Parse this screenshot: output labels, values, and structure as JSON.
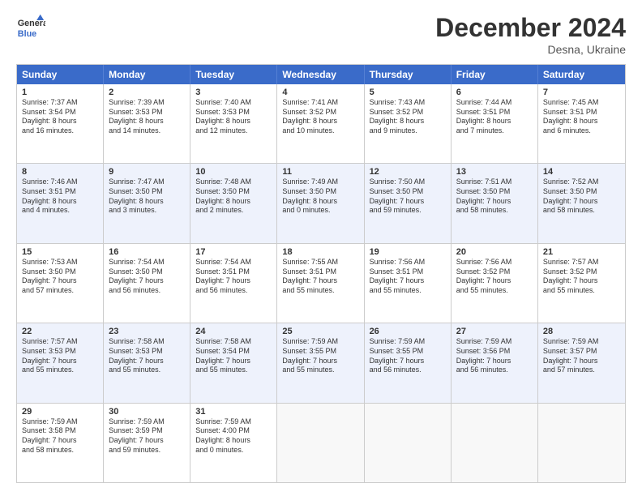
{
  "header": {
    "logo_line1": "General",
    "logo_line2": "Blue",
    "title": "December 2024",
    "subtitle": "Desna, Ukraine"
  },
  "days_of_week": [
    "Sunday",
    "Monday",
    "Tuesday",
    "Wednesday",
    "Thursday",
    "Friday",
    "Saturday"
  ],
  "weeks": [
    [
      {
        "day": "1",
        "lines": [
          "Sunrise: 7:37 AM",
          "Sunset: 3:54 PM",
          "Daylight: 8 hours",
          "and 16 minutes."
        ]
      },
      {
        "day": "2",
        "lines": [
          "Sunrise: 7:39 AM",
          "Sunset: 3:53 PM",
          "Daylight: 8 hours",
          "and 14 minutes."
        ]
      },
      {
        "day": "3",
        "lines": [
          "Sunrise: 7:40 AM",
          "Sunset: 3:53 PM",
          "Daylight: 8 hours",
          "and 12 minutes."
        ]
      },
      {
        "day": "4",
        "lines": [
          "Sunrise: 7:41 AM",
          "Sunset: 3:52 PM",
          "Daylight: 8 hours",
          "and 10 minutes."
        ]
      },
      {
        "day": "5",
        "lines": [
          "Sunrise: 7:43 AM",
          "Sunset: 3:52 PM",
          "Daylight: 8 hours",
          "and 9 minutes."
        ]
      },
      {
        "day": "6",
        "lines": [
          "Sunrise: 7:44 AM",
          "Sunset: 3:51 PM",
          "Daylight: 8 hours",
          "and 7 minutes."
        ]
      },
      {
        "day": "7",
        "lines": [
          "Sunrise: 7:45 AM",
          "Sunset: 3:51 PM",
          "Daylight: 8 hours",
          "and 6 minutes."
        ]
      }
    ],
    [
      {
        "day": "8",
        "lines": [
          "Sunrise: 7:46 AM",
          "Sunset: 3:51 PM",
          "Daylight: 8 hours",
          "and 4 minutes."
        ]
      },
      {
        "day": "9",
        "lines": [
          "Sunrise: 7:47 AM",
          "Sunset: 3:50 PM",
          "Daylight: 8 hours",
          "and 3 minutes."
        ]
      },
      {
        "day": "10",
        "lines": [
          "Sunrise: 7:48 AM",
          "Sunset: 3:50 PM",
          "Daylight: 8 hours",
          "and 2 minutes."
        ]
      },
      {
        "day": "11",
        "lines": [
          "Sunrise: 7:49 AM",
          "Sunset: 3:50 PM",
          "Daylight: 8 hours",
          "and 0 minutes."
        ]
      },
      {
        "day": "12",
        "lines": [
          "Sunrise: 7:50 AM",
          "Sunset: 3:50 PM",
          "Daylight: 7 hours",
          "and 59 minutes."
        ]
      },
      {
        "day": "13",
        "lines": [
          "Sunrise: 7:51 AM",
          "Sunset: 3:50 PM",
          "Daylight: 7 hours",
          "and 58 minutes."
        ]
      },
      {
        "day": "14",
        "lines": [
          "Sunrise: 7:52 AM",
          "Sunset: 3:50 PM",
          "Daylight: 7 hours",
          "and 58 minutes."
        ]
      }
    ],
    [
      {
        "day": "15",
        "lines": [
          "Sunrise: 7:53 AM",
          "Sunset: 3:50 PM",
          "Daylight: 7 hours",
          "and 57 minutes."
        ]
      },
      {
        "day": "16",
        "lines": [
          "Sunrise: 7:54 AM",
          "Sunset: 3:50 PM",
          "Daylight: 7 hours",
          "and 56 minutes."
        ]
      },
      {
        "day": "17",
        "lines": [
          "Sunrise: 7:54 AM",
          "Sunset: 3:51 PM",
          "Daylight: 7 hours",
          "and 56 minutes."
        ]
      },
      {
        "day": "18",
        "lines": [
          "Sunrise: 7:55 AM",
          "Sunset: 3:51 PM",
          "Daylight: 7 hours",
          "and 55 minutes."
        ]
      },
      {
        "day": "19",
        "lines": [
          "Sunrise: 7:56 AM",
          "Sunset: 3:51 PM",
          "Daylight: 7 hours",
          "and 55 minutes."
        ]
      },
      {
        "day": "20",
        "lines": [
          "Sunrise: 7:56 AM",
          "Sunset: 3:52 PM",
          "Daylight: 7 hours",
          "and 55 minutes."
        ]
      },
      {
        "day": "21",
        "lines": [
          "Sunrise: 7:57 AM",
          "Sunset: 3:52 PM",
          "Daylight: 7 hours",
          "and 55 minutes."
        ]
      }
    ],
    [
      {
        "day": "22",
        "lines": [
          "Sunrise: 7:57 AM",
          "Sunset: 3:53 PM",
          "Daylight: 7 hours",
          "and 55 minutes."
        ]
      },
      {
        "day": "23",
        "lines": [
          "Sunrise: 7:58 AM",
          "Sunset: 3:53 PM",
          "Daylight: 7 hours",
          "and 55 minutes."
        ]
      },
      {
        "day": "24",
        "lines": [
          "Sunrise: 7:58 AM",
          "Sunset: 3:54 PM",
          "Daylight: 7 hours",
          "and 55 minutes."
        ]
      },
      {
        "day": "25",
        "lines": [
          "Sunrise: 7:59 AM",
          "Sunset: 3:55 PM",
          "Daylight: 7 hours",
          "and 55 minutes."
        ]
      },
      {
        "day": "26",
        "lines": [
          "Sunrise: 7:59 AM",
          "Sunset: 3:55 PM",
          "Daylight: 7 hours",
          "and 56 minutes."
        ]
      },
      {
        "day": "27",
        "lines": [
          "Sunrise: 7:59 AM",
          "Sunset: 3:56 PM",
          "Daylight: 7 hours",
          "and 56 minutes."
        ]
      },
      {
        "day": "28",
        "lines": [
          "Sunrise: 7:59 AM",
          "Sunset: 3:57 PM",
          "Daylight: 7 hours",
          "and 57 minutes."
        ]
      }
    ],
    [
      {
        "day": "29",
        "lines": [
          "Sunrise: 7:59 AM",
          "Sunset: 3:58 PM",
          "Daylight: 7 hours",
          "and 58 minutes."
        ]
      },
      {
        "day": "30",
        "lines": [
          "Sunrise: 7:59 AM",
          "Sunset: 3:59 PM",
          "Daylight: 7 hours",
          "and 59 minutes."
        ]
      },
      {
        "day": "31",
        "lines": [
          "Sunrise: 7:59 AM",
          "Sunset: 4:00 PM",
          "Daylight: 8 hours",
          "and 0 minutes."
        ]
      },
      {
        "day": "",
        "lines": []
      },
      {
        "day": "",
        "lines": []
      },
      {
        "day": "",
        "lines": []
      },
      {
        "day": "",
        "lines": []
      }
    ]
  ]
}
